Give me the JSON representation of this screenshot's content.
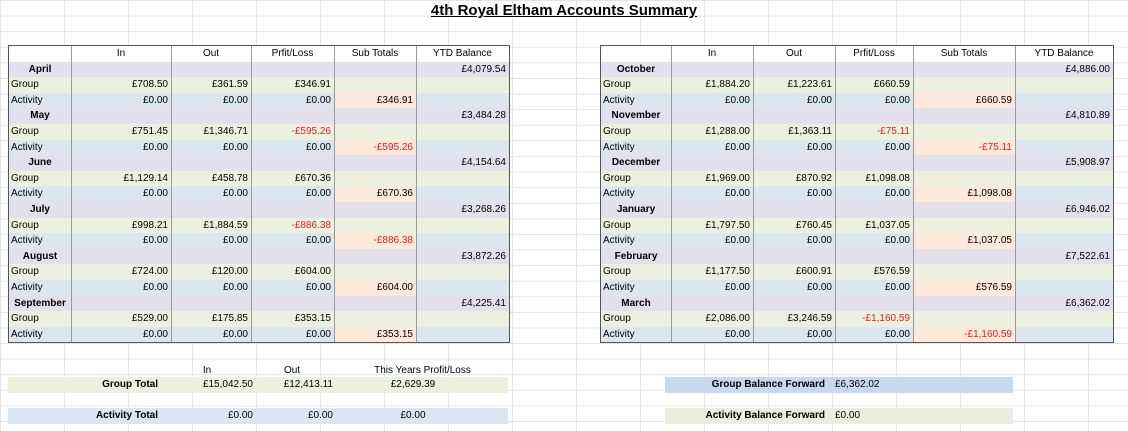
{
  "title": "4th Royal Eltham Accounts Summary",
  "columns": [
    "In",
    "Out",
    "Prfit/Loss",
    "Sub Totals",
    "YTD Balance"
  ],
  "row_labels": {
    "group": "Group",
    "activity": "Activity"
  },
  "left_months": [
    {
      "name": "April",
      "ytd": "£4,079.54",
      "group": {
        "in": "£708.50",
        "out": "£361.59",
        "pl": "£346.91",
        "pl_neg": false
      },
      "activity": {
        "in": "£0.00",
        "out": "£0.00",
        "pl": "£0.00",
        "sub": "£346.91",
        "sub_neg": false
      }
    },
    {
      "name": "May",
      "ytd": "£3,484.28",
      "group": {
        "in": "£751.45",
        "out": "£1,346.71",
        "pl": "-£595.26",
        "pl_neg": true
      },
      "activity": {
        "in": "£0.00",
        "out": "£0.00",
        "pl": "£0.00",
        "sub": "-£595.26",
        "sub_neg": true
      }
    },
    {
      "name": "June",
      "ytd": "£4,154.64",
      "group": {
        "in": "£1,129.14",
        "out": "£458.78",
        "pl": "£670.36",
        "pl_neg": false
      },
      "activity": {
        "in": "£0.00",
        "out": "£0.00",
        "pl": "£0.00",
        "sub": "£670.36",
        "sub_neg": false
      }
    },
    {
      "name": "July",
      "ytd": "£3,268.26",
      "group": {
        "in": "£998.21",
        "out": "£1,884.59",
        "pl": "-£886.38",
        "pl_neg": true
      },
      "activity": {
        "in": "£0.00",
        "out": "£0.00",
        "pl": "£0.00",
        "sub": "-£886.38",
        "sub_neg": true
      }
    },
    {
      "name": "August",
      "ytd": "£3,872.26",
      "group": {
        "in": "£724.00",
        "out": "£120.00",
        "pl": "£604.00",
        "pl_neg": false
      },
      "activity": {
        "in": "£0.00",
        "out": "£0.00",
        "pl": "£0.00",
        "sub": "£604.00",
        "sub_neg": false
      }
    },
    {
      "name": "September",
      "ytd": "£4,225.41",
      "group": {
        "in": "£529.00",
        "out": "£175.85",
        "pl": "£353.15",
        "pl_neg": false
      },
      "activity": {
        "in": "£0.00",
        "out": "£0.00",
        "pl": "£0.00",
        "sub": "£353.15",
        "sub_neg": false
      }
    }
  ],
  "right_months": [
    {
      "name": "October",
      "ytd": "£4,886.00",
      "group": {
        "in": "£1,884.20",
        "out": "£1,223.61",
        "pl": "£660.59",
        "pl_neg": false
      },
      "activity": {
        "in": "£0.00",
        "out": "£0.00",
        "pl": "£0.00",
        "sub": "£660.59",
        "sub_neg": false
      }
    },
    {
      "name": "November",
      "ytd": "£4,810.89",
      "group": {
        "in": "£1,288.00",
        "out": "£1,363.11",
        "pl": "-£75.11",
        "pl_neg": true
      },
      "activity": {
        "in": "£0.00",
        "out": "£0.00",
        "pl": "£0.00",
        "sub": "-£75.11",
        "sub_neg": true
      }
    },
    {
      "name": "December",
      "ytd": "£5,908.97",
      "group": {
        "in": "£1,969.00",
        "out": "£870.92",
        "pl": "£1,098.08",
        "pl_neg": false
      },
      "activity": {
        "in": "£0.00",
        "out": "£0.00",
        "pl": "£0.00",
        "sub": "£1,098.08",
        "sub_neg": false
      }
    },
    {
      "name": "January",
      "ytd": "£6,946.02",
      "group": {
        "in": "£1,797.50",
        "out": "£760.45",
        "pl": "£1,037.05",
        "pl_neg": false
      },
      "activity": {
        "in": "£0.00",
        "out": "£0.00",
        "pl": "£0.00",
        "sub": "£1,037.05",
        "sub_neg": false
      }
    },
    {
      "name": "February",
      "ytd": "£7,522.61",
      "group": {
        "in": "£1,177.50",
        "out": "£600.91",
        "pl": "£576.59",
        "pl_neg": false
      },
      "activity": {
        "in": "£0.00",
        "out": "£0.00",
        "pl": "£0.00",
        "sub": "£576.59",
        "sub_neg": false
      }
    },
    {
      "name": "March",
      "ytd": "£6,362.02",
      "group": {
        "in": "£2,086.00",
        "out": "£3,246.59",
        "pl": "-£1,160.59",
        "pl_neg": true
      },
      "activity": {
        "in": "£0.00",
        "out": "£0.00",
        "pl": "£0.00",
        "sub": "-£1,160.59",
        "sub_neg": true
      }
    }
  ],
  "summary": {
    "in_header": "In",
    "out_header": "Out",
    "pl_header": "This Years Profit/Loss",
    "group_total_label": "Group Total",
    "group_total_in": "£15,042.50",
    "group_total_out": "£12,413.11",
    "group_total_pl": "£2,629.39",
    "activity_total_label": "Activity Total",
    "activity_total_in": "£0.00",
    "activity_total_out": "£0.00",
    "activity_total_pl": "£0.00",
    "group_balance_label": "Group Balance Forward",
    "group_balance_value": "£6,362.02",
    "activity_balance_label": "Activity Balance Forward",
    "activity_balance_value": "£0.00"
  },
  "colors": {
    "month_row": "#e4dfec",
    "group_row": "#ebf1de",
    "activity_row": "#dce6f1",
    "subtotal": "#fde9d9",
    "negative": "#e02020"
  }
}
